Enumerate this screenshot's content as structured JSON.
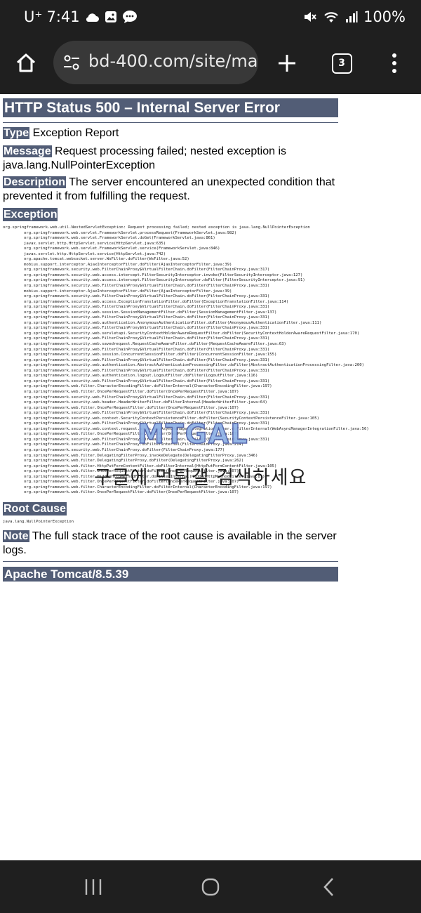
{
  "status_bar": {
    "carrier": "U⁺",
    "time": "7:41",
    "battery": "100%",
    "notification_icons": [
      "cloud-icon",
      "gallery-icon",
      "chat-icon"
    ],
    "system_icons": [
      "mute-icon",
      "wifi-icon",
      "signal-icon"
    ]
  },
  "browser": {
    "url": "bd-400.com/site/mai",
    "tab_count": "3",
    "icons": [
      "home-icon",
      "site-settings-icon",
      "plus-icon",
      "menu-icon"
    ]
  },
  "error_page": {
    "title": "HTTP Status 500 – Internal Server Error",
    "type_label": "Type",
    "type_value": " Exception Report",
    "message_label": "Message",
    "message_value": " Request processing failed; nested exception is java.lang.NullPointerException",
    "description_label": "Description",
    "description_value": " The server encountered an unexpected condition that prevented it from fulfilling the request.",
    "exception_heading": "Exception",
    "stack_trace": [
      "org.springframework.web.util.NestedServletException: Request processing failed; nested exception is java.lang.NullPointerException",
      "org.springframework.web.servlet.FrameworkServlet.processRequest(FrameworkServlet.java:982)",
      "org.springframework.web.servlet.FrameworkServlet.doGet(FrameworkServlet.java:861)",
      "javax.servlet.http.HttpServlet.service(HttpServlet.java:635)",
      "org.springframework.web.servlet.FrameworkServlet.service(FrameworkServlet.java:846)",
      "javax.servlet.http.HttpServlet.service(HttpServlet.java:742)",
      "org.apache.tomcat.websocket.server.WsFilter.doFilter(WsFilter.java:52)",
      "mobius.support.interceptor.AjaxInterceptorFilter.doFilter(AjaxInterceptorFilter.java:39)",
      "org.springframework.security.web.FilterChainProxy$VirtualFilterChain.doFilter(FilterChainProxy.java:317)",
      "org.springframework.security.web.access.intercept.FilterSecurityInterceptor.invoke(FilterSecurityInterceptor.java:127)",
      "org.springframework.security.web.access.intercept.FilterSecurityInterceptor.doFilter(FilterSecurityInterceptor.java:91)",
      "org.springframework.security.web.FilterChainProxy$VirtualFilterChain.doFilter(FilterChainProxy.java:331)",
      "mobius.support.interceptor.AjaxInterceptorFilter.doFilter(AjaxInterceptorFilter.java:39)",
      "org.springframework.security.web.FilterChainProxy$VirtualFilterChain.doFilter(FilterChainProxy.java:331)",
      "org.springframework.security.web.access.ExceptionTranslationFilter.doFilter(ExceptionTranslationFilter.java:114)",
      "org.springframework.security.web.FilterChainProxy$VirtualFilterChain.doFilter(FilterChainProxy.java:331)",
      "org.springframework.security.web.session.SessionManagementFilter.doFilter(SessionManagementFilter.java:137)",
      "org.springframework.security.web.FilterChainProxy$VirtualFilterChain.doFilter(FilterChainProxy.java:331)",
      "org.springframework.security.web.authentication.AnonymousAuthenticationFilter.doFilter(AnonymousAuthenticationFilter.java:111)",
      "org.springframework.security.web.FilterChainProxy$VirtualFilterChain.doFilter(FilterChainProxy.java:331)",
      "org.springframework.security.web.servletapi.SecurityContextHolderAwareRequestFilter.doFilter(SecurityContextHolderAwareRequestFilter.java:170)",
      "org.springframework.security.web.FilterChainProxy$VirtualFilterChain.doFilter(FilterChainProxy.java:331)",
      "org.springframework.security.web.savedrequest.RequestCacheAwareFilter.doFilter(RequestCacheAwareFilter.java:63)",
      "org.springframework.security.web.FilterChainProxy$VirtualFilterChain.doFilter(FilterChainProxy.java:331)",
      "org.springframework.security.web.session.ConcurrentSessionFilter.doFilter(ConcurrentSessionFilter.java:155)",
      "org.springframework.security.web.FilterChainProxy$VirtualFilterChain.doFilter(FilterChainProxy.java:331)",
      "org.springframework.security.web.authentication.AbstractAuthenticationProcessingFilter.doFilter(AbstractAuthenticationProcessingFilter.java:200)",
      "org.springframework.security.web.FilterChainProxy$VirtualFilterChain.doFilter(FilterChainProxy.java:331)",
      "org.springframework.security.web.authentication.logout.LogoutFilter.doFilter(LogoutFilter.java:116)",
      "org.springframework.security.web.FilterChainProxy$VirtualFilterChain.doFilter(FilterChainProxy.java:331)",
      "org.springframework.web.filter.CharacterEncodingFilter.doFilterInternal(CharacterEncodingFilter.java:197)",
      "org.springframework.web.filter.OncePerRequestFilter.doFilter(OncePerRequestFilter.java:107)",
      "org.springframework.security.web.FilterChainProxy$VirtualFilterChain.doFilter(FilterChainProxy.java:331)",
      "org.springframework.security.web.header.HeaderWriterFilter.doFilterInternal(HeaderWriterFilter.java:64)",
      "org.springframework.web.filter.OncePerRequestFilter.doFilter(OncePerRequestFilter.java:107)",
      "org.springframework.security.web.FilterChainProxy$VirtualFilterChain.doFilter(FilterChainProxy.java:331)",
      "org.springframework.security.web.context.SecurityContextPersistenceFilter.doFilter(SecurityContextPersistenceFilter.java:105)",
      "org.springframework.security.web.FilterChainProxy$VirtualFilterChain.doFilter(FilterChainProxy.java:331)",
      "org.springframework.security.web.context.request.async.WebAsyncManagerIntegrationFilter.doFilterInternal(WebAsyncManagerIntegrationFilter.java:56)",
      "org.springframework.web.filter.OncePerRequestFilter.doFilter(OncePerRequestFilter.java:107)",
      "org.springframework.security.web.FilterChainProxy$VirtualFilterChain.doFilter(FilterChainProxy.java:331)",
      "org.springframework.security.web.FilterChainProxy.doFilterInternal(FilterChainProxy.java:214)",
      "org.springframework.security.web.FilterChainProxy.doFilter(FilterChainProxy.java:177)",
      "org.springframework.web.filter.DelegatingFilterProxy.invokeDelegate(DelegatingFilterProxy.java:346)",
      "org.springframework.web.filter.DelegatingFilterProxy.doFilter(DelegatingFilterProxy.java:262)",
      "org.springframework.web.filter.HttpPutFormContentFilter.doFilterInternal(HttpPutFormContentFilter.java:105)",
      "org.springframework.web.filter.OncePerRequestFilter.doFilter(OncePerRequestFilter.java:107)",
      "org.springframework.web.filter.HiddenHttpMethodFilter.doFilterInternal(HiddenHttpMethodFilter.java:81)",
      "org.springframework.web.filter.OncePerRequestFilter.doFilter(OncePerRequestFilter.java:107)",
      "org.springframework.web.filter.CharacterEncodingFilter.doFilterInternal(CharacterEncodingFilter.java:197)",
      "org.springframework.web.filter.OncePerRequestFilter.doFilter(OncePerRequestFilter.java:107)"
    ],
    "root_cause_heading": "Root Cause",
    "root_cause_trace": "java.lang.NullPointerException",
    "note_label": "Note",
    "note_value": " The full stack trace of the root cause is available in the server logs.",
    "footer": "Apache Tomcat/8.5.39",
    "header_color": "#525d76"
  },
  "watermark": {
    "logo": "MTGAL",
    "subtitle": "구글에 먹튀갤 검색하세요"
  },
  "nav_bar": {
    "icons": [
      "recents-icon",
      "home-circle-icon",
      "back-icon"
    ]
  }
}
